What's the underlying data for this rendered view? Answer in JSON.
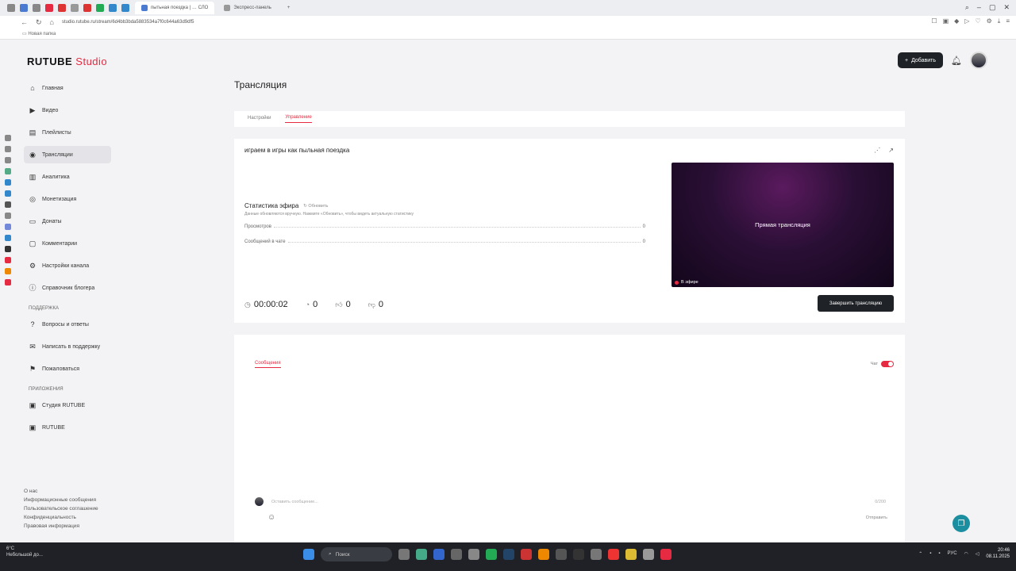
{
  "browser": {
    "tabs": [
      {
        "label": "пытьная поездка | … СЛО",
        "active": true
      },
      {
        "label": "Экспресс-панель",
        "active": false
      }
    ],
    "url": "studio.rutube.ru/stream/6d4bb3bda5883534a7f0c644a63d9df5",
    "bookmark": "Новая папка"
  },
  "header": {
    "logo_main": "RUTUBE",
    "logo_studio": "Studio",
    "add_label": "Добавить"
  },
  "sidebar": {
    "items": [
      {
        "label": "Главная",
        "icon": "home-icon"
      },
      {
        "label": "Видео",
        "icon": "video-icon"
      },
      {
        "label": "Плейлисты",
        "icon": "playlist-icon"
      },
      {
        "label": "Трансляции",
        "icon": "broadcast-icon"
      },
      {
        "label": "Аналитика",
        "icon": "chart-icon"
      },
      {
        "label": "Монетизация",
        "icon": "money-icon"
      },
      {
        "label": "Донаты",
        "icon": "donate-icon"
      },
      {
        "label": "Комментарии",
        "icon": "comment-icon"
      },
      {
        "label": "Настройки канала",
        "icon": "gear-icon"
      },
      {
        "label": "Справочник блогера",
        "icon": "info-icon"
      }
    ],
    "support_title": "Поддержка",
    "support_items": [
      {
        "label": "Вопросы и ответы",
        "icon": "question-icon"
      },
      {
        "label": "Написать в поддержку",
        "icon": "mail-icon"
      },
      {
        "label": "Пожаловаться",
        "icon": "flag-icon"
      }
    ],
    "apps_title": "Приложения",
    "apps_items": [
      {
        "label": "Студия RUTUBE",
        "icon": "studio-app-icon"
      },
      {
        "label": "RUTUBE",
        "icon": "rutube-app-icon"
      }
    ],
    "footer": [
      "О нас",
      "Информационные сообщения",
      "Пользовательское соглашение",
      "Конфиденциальность",
      "Правовая информация"
    ]
  },
  "main": {
    "page_title": "Трансляция",
    "tabs": [
      {
        "label": "Настройки",
        "active": false
      },
      {
        "label": "Управление",
        "active": true
      }
    ],
    "stream_title": "играем в игры как пыльная поездка",
    "stats": {
      "heading": "Статистика эфира",
      "refresh_label": "Обновить",
      "note": "Данные обновляются вручную. Нажмите «Обновить», чтобы видеть актуальную статистику",
      "rows": [
        {
          "label": "Просмотров",
          "value": "0"
        },
        {
          "label": "Сообщений в чате",
          "value": "0"
        }
      ]
    },
    "counters": {
      "duration": "00:00:02",
      "viewers": "0",
      "likes": "0",
      "dislikes": "0"
    },
    "preview": {
      "text": "Прямая трансляция",
      "live_label": "В эфире"
    },
    "end_button": "Завершить трансляцию"
  },
  "chat": {
    "tab_label": "Сообщения",
    "toggle_label": "Чат",
    "toggle_on": true,
    "input_placeholder": "Оставить сообщение...",
    "counter": "0/200",
    "send_label": "Отправить"
  },
  "taskbar": {
    "weather_temp": "6°C",
    "weather_text": "Небольшой до...",
    "search_label": "Поиск",
    "lang": "РУС",
    "time": "20:46",
    "date": "08.11.2025"
  },
  "colors": {
    "accent": "#e52a41",
    "dark_button": "#1f2226"
  }
}
